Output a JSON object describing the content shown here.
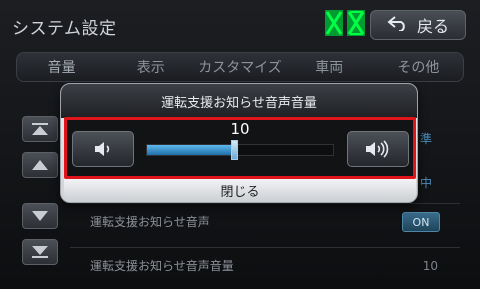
{
  "header": {
    "title": "システム設定",
    "back_label": "戻る",
    "status_icons": [
      "nav-status-icon",
      "signal-status-icon"
    ]
  },
  "tabs": [
    {
      "label": "音量"
    },
    {
      "label": "表示"
    },
    {
      "label": "カスタマイズ"
    },
    {
      "label": "車両"
    },
    {
      "label": "その他"
    }
  ],
  "side_buttons": [
    "page-top-icon",
    "up-icon",
    "down-icon",
    "page-bottom-icon"
  ],
  "list": {
    "peek_1": "準",
    "peek_2": "中",
    "rows": [
      {
        "label": "運転支援お知らせ音声",
        "value": "ON"
      },
      {
        "label": "運転支援お知らせ音声音量",
        "value": "10"
      }
    ]
  },
  "dialog": {
    "title": "運転支援お知らせ音声音量",
    "value": "10",
    "level_fraction": 0.47,
    "close_label": "閉じる",
    "accent": "#e0141b"
  }
}
